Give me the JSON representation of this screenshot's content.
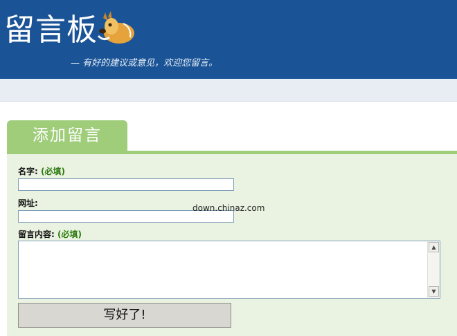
{
  "header": {
    "title": "留言板",
    "subtitle": "— 有好的建议或意见，欢迎您留言。"
  },
  "tab": {
    "label": "添加留言"
  },
  "form": {
    "name_label": "名字:",
    "name_required": "(必填)",
    "name_value": "",
    "url_label": "网址:",
    "url_value": "",
    "content_label": "留言内容:",
    "content_required": "(必填)",
    "content_value": "",
    "submit_label": "写好了!"
  },
  "watermark": "down.chinaz.com",
  "colors": {
    "header_bg": "#1b5496",
    "tab_green": "#9fcd7a",
    "panel_bg": "#eaf3e1",
    "required_green": "#2f7a12"
  }
}
